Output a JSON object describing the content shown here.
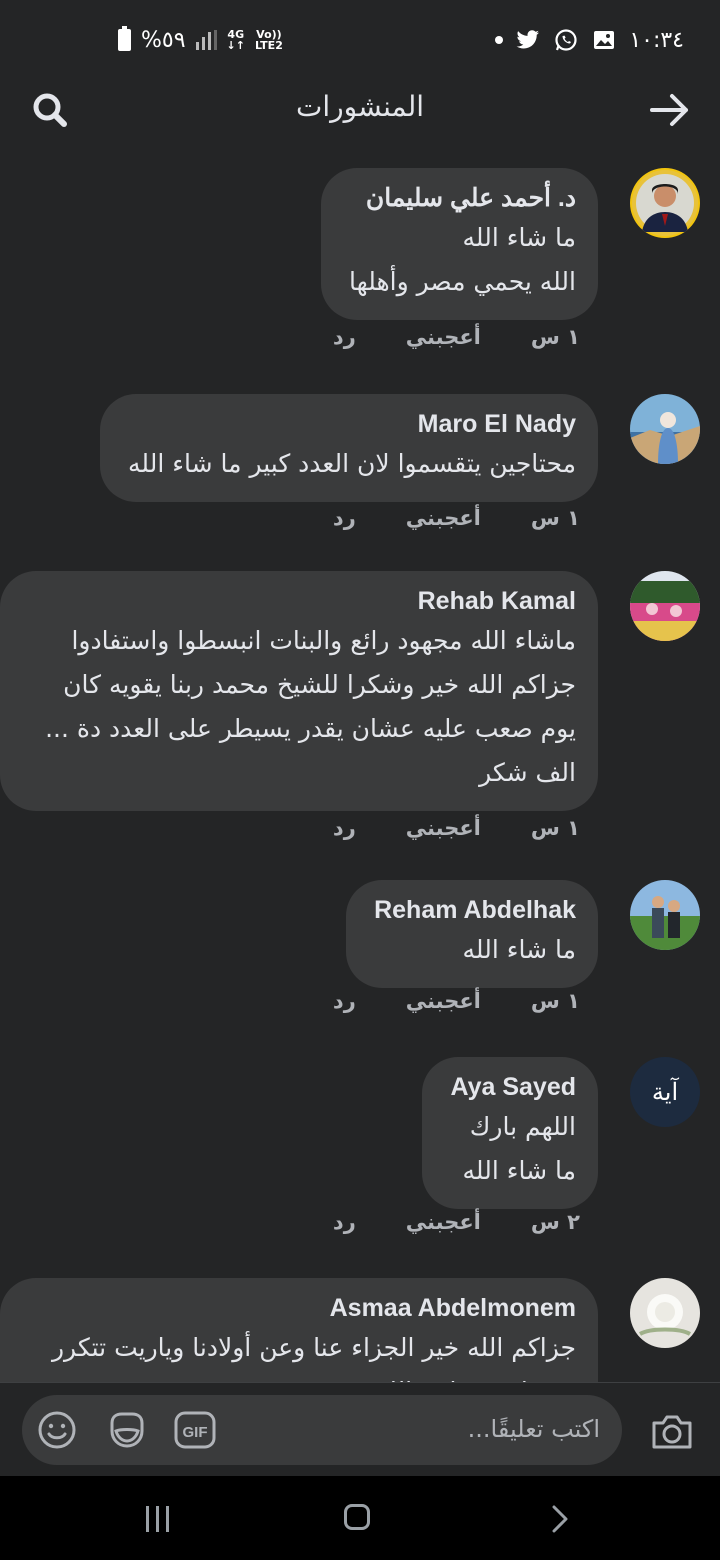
{
  "status_bar": {
    "battery": "%٥٩",
    "network_top": "4G",
    "network_volte": "Vo))",
    "network_lte": "LTE2",
    "time": "١٠:٣٤"
  },
  "header": {
    "title": "المنشورات"
  },
  "comments": [
    {
      "name": "د. أحمد علي سليمان",
      "text": "ما شاء الله\nالله يحمي مصر وأهلها",
      "time": "١ س",
      "like": "أعجبني",
      "reply": "رد"
    },
    {
      "name": "Maro El Nady",
      "text": "محتاجين يتقسموا لان العدد كبير ما شاء الله",
      "time": "١ س",
      "like": "أعجبني",
      "reply": "رد"
    },
    {
      "name": "Rehab Kamal",
      "text": "ماشاء الله مجهود رائع والبنات انبسطوا واستفادوا جزاكم الله خير وشكرا للشيخ محمد ربنا يقويه كان يوم صعب عليه عشان يقدر يسيطر على العدد دة ... الف شكر",
      "time": "١ س",
      "like": "أعجبني",
      "reply": "رد"
    },
    {
      "name": "Reham Abdelhak",
      "text": "ما شاء الله",
      "time": "١ س",
      "like": "أعجبني",
      "reply": "رد"
    },
    {
      "name": "Aya Sayed",
      "text": "اللهم بارك\nما شاء الله",
      "time": "٢ س",
      "like": "أعجبني",
      "reply": "رد",
      "avatar_text": "آية"
    },
    {
      "name": "Asmaa Abdelmonem",
      "text": "جزاكم الله خير الجزاء عنا وعن أولادنا وياريت تتكرر مرة اخرى بإذن الله",
      "time": "",
      "like": "",
      "reply": ""
    }
  ],
  "input": {
    "placeholder": "اكتب تعليقًا...",
    "gif_label": "GIF"
  },
  "colors": {
    "background": "#242526",
    "bubble": "#3a3b3c",
    "text": "#e4e6eb",
    "muted": "#b0b3b8"
  }
}
